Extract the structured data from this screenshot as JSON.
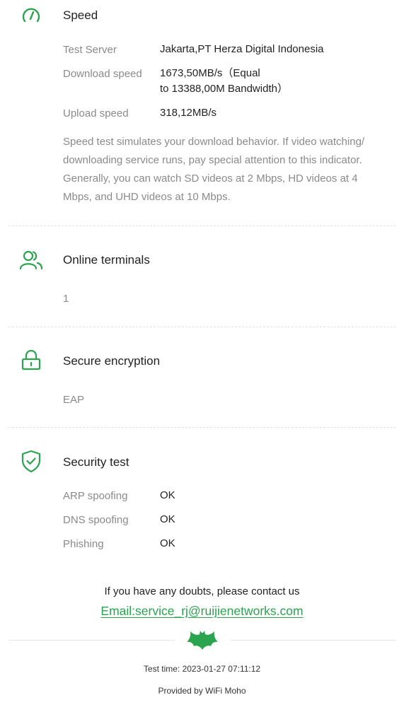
{
  "speed": {
    "title": "Speed",
    "rows": [
      {
        "label": "Test Server",
        "value": "Jakarta,PT Herza Digital Indonesia"
      },
      {
        "label": "Download speed",
        "value_line1": "1673,50MB/s（Equal",
        "value_line2": "to 13388,00M Bandwidth）"
      },
      {
        "label": "Upload speed",
        "value": "318,12MB/s"
      }
    ],
    "description": "Speed test simulates your download behavior. If video watching/ downloading service runs, pay special attention to this indicator. Generally, you can watch SD videos at 2 Mbps, HD videos at 4 Mbps, and UHD videos at 10 Mbps."
  },
  "terminals": {
    "title": "Online terminals",
    "value": "1"
  },
  "encryption": {
    "title": "Secure encryption",
    "value": "EAP"
  },
  "security": {
    "title": "Security test",
    "rows": [
      {
        "label": "ARP spoofing",
        "value": "OK"
      },
      {
        "label": "DNS spoofing",
        "value": "OK"
      },
      {
        "label": "Phishing",
        "value": "OK"
      }
    ]
  },
  "contact": {
    "text": "If you have any doubts, please contact us",
    "email": "Email:service_rj@ruijienetworks.com"
  },
  "footer": {
    "test_time": "Test time: 2023-01-27 07:11:12",
    "provided_by": "Provided by WiFi Moho"
  },
  "colors": {
    "accent": "#2aa44f",
    "muted": "#8a8a8a",
    "text": "#222222"
  }
}
